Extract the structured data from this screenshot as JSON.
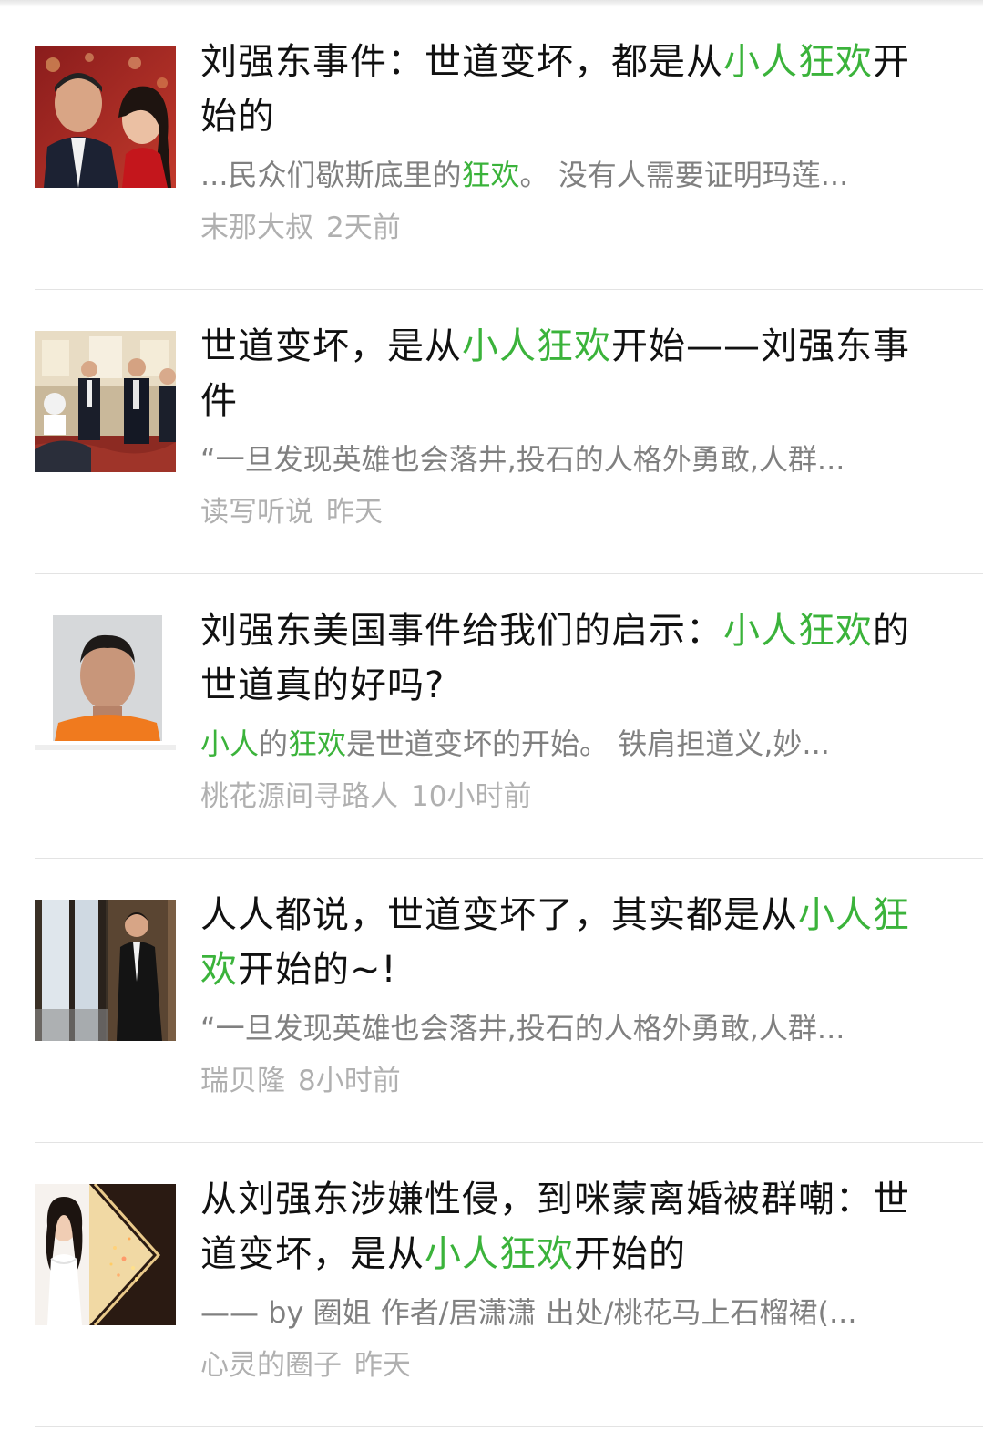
{
  "accent_color": "#3bb33b",
  "results": [
    {
      "title": [
        {
          "t": "刘强东事件：世道变坏，都是从"
        },
        {
          "t": "小人狂欢",
          "hl": true
        },
        {
          "t": "开始的"
        }
      ],
      "snippet": [
        {
          "t": "...民众们歇斯底里的"
        },
        {
          "t": "狂欢",
          "hl": true
        },
        {
          "t": "。 没有人需要证明玛莲..."
        }
      ],
      "source": "末那大叔",
      "time": "2天前",
      "thumb_icon": "couple-photo-thumbnail"
    },
    {
      "title": [
        {
          "t": "世道变坏，是从"
        },
        {
          "t": "小人狂欢",
          "hl": true
        },
        {
          "t": "开始——刘强东事件"
        }
      ],
      "snippet": [
        {
          "t": "“一旦发现英雄也会落井,投石的人格外勇敢,人群..."
        }
      ],
      "source": "读写听说",
      "time": "昨天",
      "thumb_icon": "meeting-photo-thumbnail"
    },
    {
      "title": [
        {
          "t": "刘强东美国事件给我们的启示："
        },
        {
          "t": "小人狂欢",
          "hl": true
        },
        {
          "t": "的世道真的好吗?"
        }
      ],
      "snippet": [
        {
          "t": "小人",
          "hl": true
        },
        {
          "t": "的"
        },
        {
          "t": "狂欢",
          "hl": true
        },
        {
          "t": "是世道变坏的开始。 铁肩担道义,妙..."
        }
      ],
      "source": "桃花源间寻路人",
      "time": "10小时前",
      "thumb_icon": "mugshot-thumbnail"
    },
    {
      "title": [
        {
          "t": "人人都说，世道变坏了，其实都是从"
        },
        {
          "t": "小人狂欢",
          "hl": true
        },
        {
          "t": "开始的~!"
        }
      ],
      "snippet": [
        {
          "t": "“一旦发现英雄也会落井,投石的人格外勇敢,人群..."
        }
      ],
      "source": "瑞贝隆",
      "time": "8小时前",
      "thumb_icon": "man-at-window-thumbnail"
    },
    {
      "title": [
        {
          "t": "从刘强东涉嫌性侵，到咪蒙离婚被群嘲：世道变坏，是从"
        },
        {
          "t": "小人狂欢",
          "hl": true
        },
        {
          "t": "开始的"
        }
      ],
      "snippet": [
        {
          "t": "—— by 圈姐 作者/居潇潇 出处/桃花马上石榴裙(..."
        }
      ],
      "source": "心灵的圈子",
      "time": "昨天",
      "thumb_icon": "woman-portrait-thumbnail"
    }
  ]
}
